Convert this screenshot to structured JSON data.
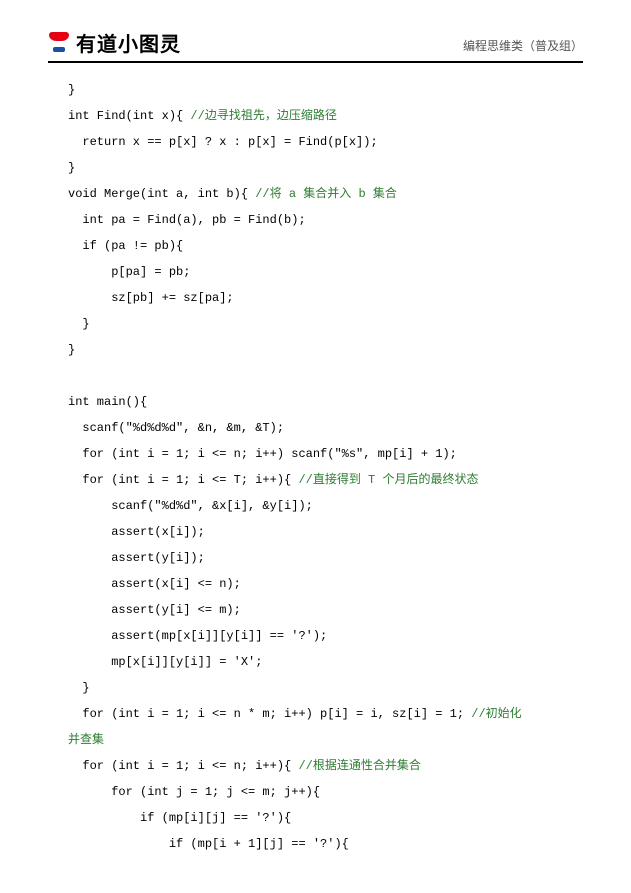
{
  "header": {
    "brand": "有道小图灵",
    "category": "编程思维类（普及组）"
  },
  "code": {
    "l01": "}",
    "l02a": "int Find(int x){ ",
    "l02c": "//边寻找祖先，边压缩路径",
    "l03": "  return x == p[x] ? x : p[x] = Find(p[x]);",
    "l04": "}",
    "l05a": "void Merge(int a, int b){ ",
    "l05c": "//将 a 集合并入 b 集合",
    "l06": "  int pa = Find(a), pb = Find(b);",
    "l07": "  if (pa != pb){",
    "l08": "      p[pa] = pb;",
    "l09": "      sz[pb] += sz[pa];",
    "l10": "  }",
    "l11": "}",
    "l12": "",
    "l13": "int main(){",
    "l14": "  scanf(\"%d%d%d\", &n, &m, &T);",
    "l15": "  for (int i = 1; i <= n; i++) scanf(\"%s\", mp[i] + 1);",
    "l16a": "  for (int i = 1; i <= T; i++){ ",
    "l16c": "//直接得到 T 个月后的最终状态",
    "l17": "      scanf(\"%d%d\", &x[i], &y[i]);",
    "l18": "      assert(x[i]);",
    "l19": "      assert(y[i]);",
    "l20": "      assert(x[i] <= n);",
    "l21": "      assert(y[i] <= m);",
    "l22": "      assert(mp[x[i]][y[i]] == '?');",
    "l23": "      mp[x[i]][y[i]] = 'X';",
    "l24": "  }",
    "l25a": "  for (int i = 1; i <= n * m; i++) p[i] = i, sz[i] = 1; ",
    "l25c": "//初始化",
    "l26c": "并查集",
    "l27a": "  for (int i = 1; i <= n; i++){ ",
    "l27c": "//根据连通性合并集合",
    "l28": "      for (int j = 1; j <= m; j++){",
    "l29": "          if (mp[i][j] == '?'){",
    "l30": "              if (mp[i + 1][j] == '?'){"
  }
}
